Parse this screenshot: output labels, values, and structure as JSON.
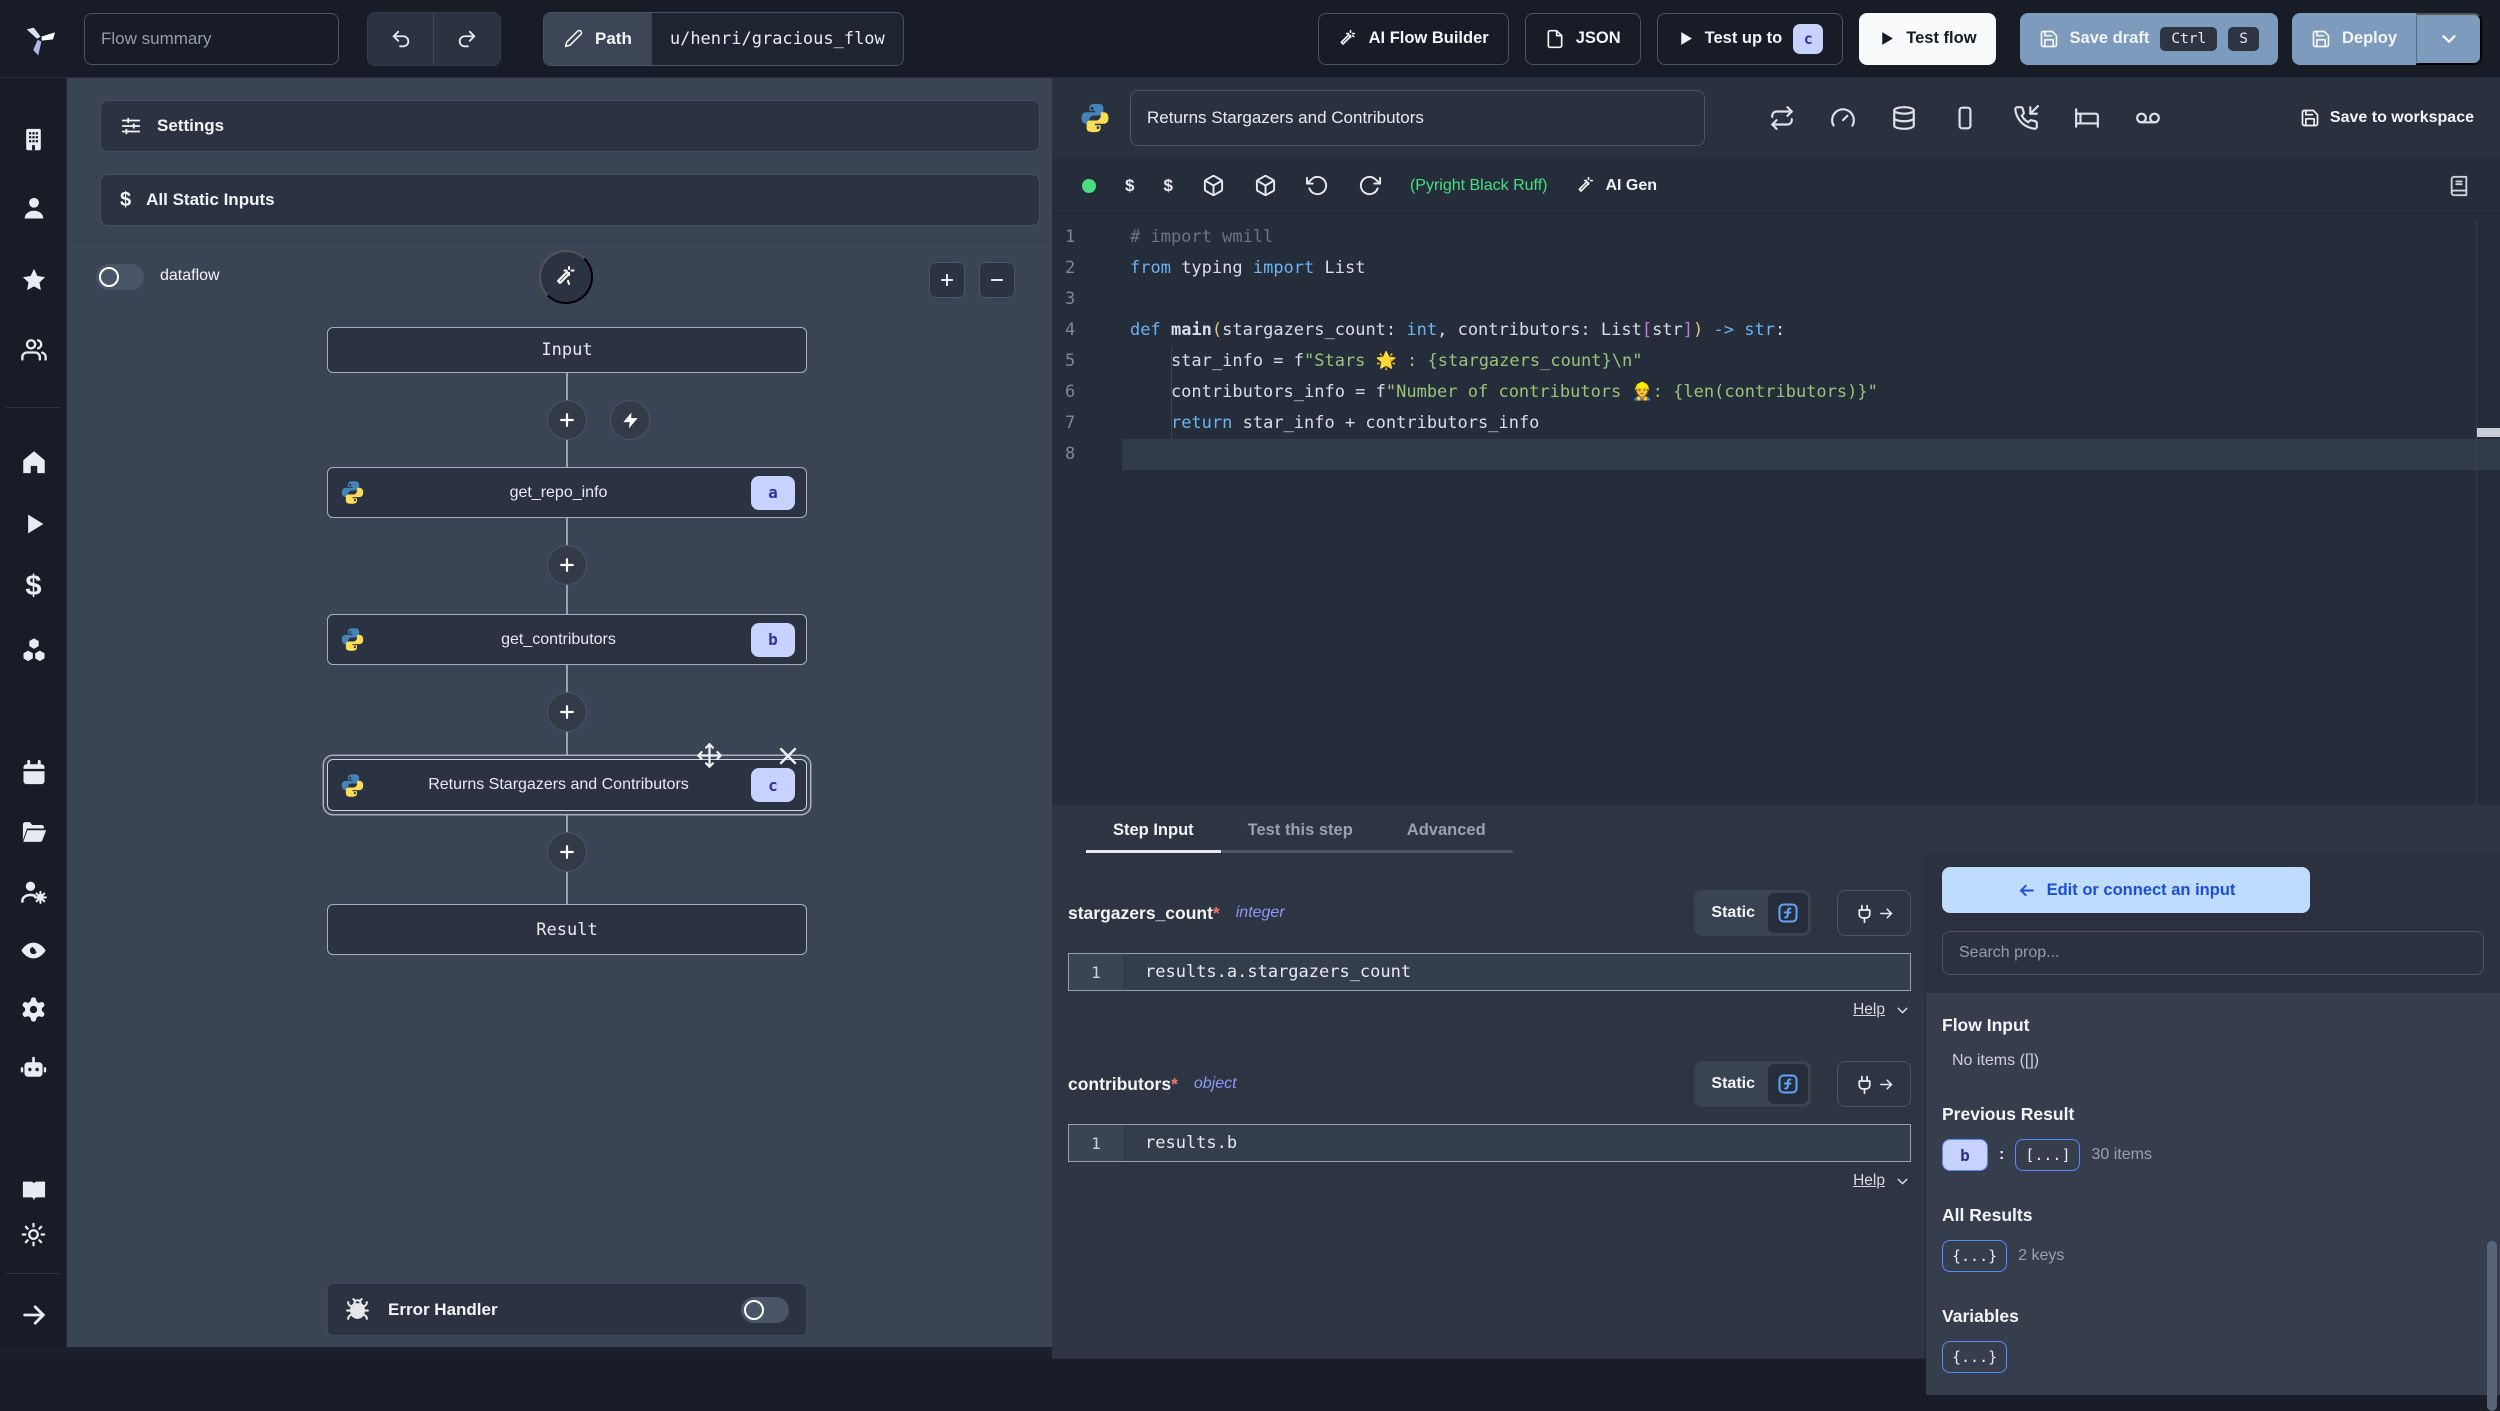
{
  "topbar": {
    "flow_summary_placeholder": "Flow summary",
    "path_label": "Path",
    "path_value": "u/henri/gracious_flow",
    "ai_flow_builder_label": "AI Flow Builder",
    "json_label": "JSON",
    "test_up_to_label": "Test up to",
    "test_up_to_badge": "c",
    "test_flow_label": "Test flow",
    "save_draft_label": "Save draft",
    "save_draft_kbd_1": "Ctrl",
    "save_draft_kbd_2": "S",
    "deploy_label": "Deploy"
  },
  "flow_panel": {
    "settings_label": "Settings",
    "static_inputs_label": "All Static Inputs",
    "dollar_icon": "$",
    "dataflow_label": "dataflow",
    "input_node": "Input",
    "steps": [
      {
        "label": "get_repo_info",
        "badge": "a"
      },
      {
        "label": "get_contributors",
        "badge": "b"
      },
      {
        "label": "Returns Stargazers and Contributors",
        "badge": "c"
      }
    ],
    "result_node": "Result",
    "error_handler_label": "Error Handler"
  },
  "editor": {
    "title": "Returns Stargazers and Contributors",
    "save_to_workspace_label": "Save to workspace",
    "dollar_icon": "$",
    "lint_status": "(Pyright Black Ruff)",
    "ai_gen_label": "AI Gen",
    "active_line": 8,
    "indent_guide_lines": [
      5,
      6,
      7
    ],
    "syntax_colors": {
      "keyword": "#6db3f2",
      "plain": "#d8dee9",
      "string": "#9ac379",
      "comment": "#6a7385",
      "bracket_yellow": "#e5c07b",
      "bracket_magenta": "#c678dd"
    },
    "code": [
      [
        {
          "c": "#6a7385",
          "t": "# import wmill"
        }
      ],
      [
        {
          "c": "#6db3f2",
          "t": "from"
        },
        {
          "c": "#d8dee9",
          "t": " typing "
        },
        {
          "c": "#6db3f2",
          "t": "import"
        },
        {
          "c": "#d8dee9",
          "t": " List"
        }
      ],
      [],
      [
        {
          "c": "#6db3f2",
          "t": "def "
        },
        {
          "c": "#d8dee9",
          "t": "main",
          "b": true
        },
        {
          "c": "#e5c07b",
          "t": "("
        },
        {
          "c": "#d8dee9",
          "t": "stargazers_count: "
        },
        {
          "c": "#6db3f2",
          "t": "int"
        },
        {
          "c": "#d8dee9",
          "t": ", contributors: List"
        },
        {
          "c": "#c678dd",
          "t": "["
        },
        {
          "c": "#d8dee9",
          "t": "str"
        },
        {
          "c": "#c678dd",
          "t": "]"
        },
        {
          "c": "#e5c07b",
          "t": ")"
        },
        {
          "c": "#6db3f2",
          "t": " -> str"
        },
        {
          "c": "#d8dee9",
          "t": ":"
        }
      ],
      [
        {
          "c": "#d8dee9",
          "t": "    star_info = f"
        },
        {
          "c": "#9ac379",
          "t": "\"Stars 🌟 : {stargazers_count}\\n\""
        }
      ],
      [
        {
          "c": "#d8dee9",
          "t": "    contributors_info = f"
        },
        {
          "c": "#9ac379",
          "t": "\"Number of contributors 👷: {len(contributors)}\""
        }
      ],
      [
        {
          "c": "#d8dee9",
          "t": "    "
        },
        {
          "c": "#6db3f2",
          "t": "return"
        },
        {
          "c": "#d8dee9",
          "t": " star_info + contributors_info"
        }
      ],
      []
    ]
  },
  "step_panel": {
    "tabs": [
      {
        "label": "Step Input"
      },
      {
        "label": "Test this step"
      },
      {
        "label": "Advanced"
      }
    ],
    "fields": [
      {
        "name": "stargazers_count",
        "required_mark": "*",
        "type": "integer",
        "mode": "Static",
        "line_no": "1",
        "value": "results.a.stargazers_count",
        "help_label": "Help"
      },
      {
        "name": "contributors",
        "required_mark": "*",
        "type": "object",
        "mode": "Static",
        "line_no": "1",
        "value": "results.b",
        "help_label": "Help"
      }
    ]
  },
  "connect_panel": {
    "edit_button_label": "Edit or connect an input",
    "search_placeholder": "Search prop...",
    "flow_input_title": "Flow Input",
    "flow_input_empty": "No items ([])",
    "previous_result_title": "Previous Result",
    "previous_result_badge": "b",
    "previous_result_colon": ":",
    "previous_result_collapsed": "[...]",
    "previous_result_count": "30 items",
    "all_results_title": "All Results",
    "all_results_collapsed": "{...}",
    "all_results_count": "2 keys",
    "variables_title": "Variables",
    "variables_collapsed": "{...}"
  },
  "colors": {
    "accent_button": "#7d9bbd",
    "badge_bg": "#c7d2fe",
    "badge_text": "#3730a3",
    "connect_button_bg": "#bfdbfe",
    "connect_button_text": "#1d4ed8",
    "lint_ok": "#4ade80",
    "function_icon": "#60a5fa",
    "type_text": "#8e97f5",
    "required_mark": "#f87171"
  }
}
